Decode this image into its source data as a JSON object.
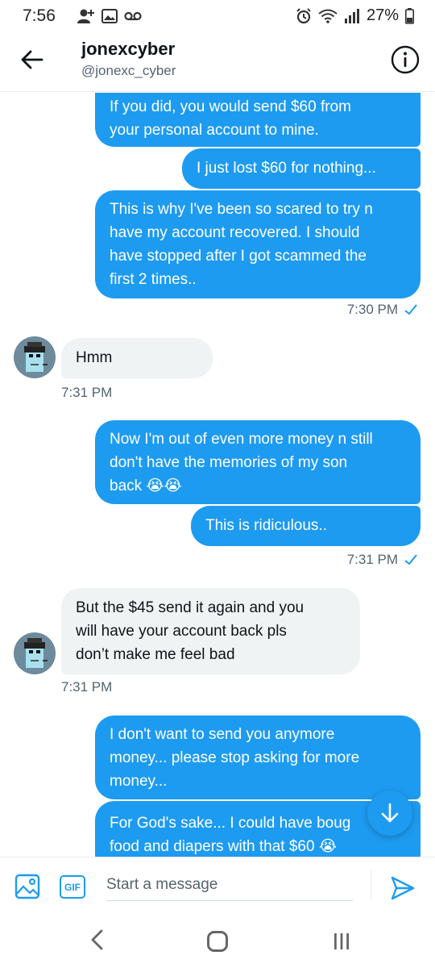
{
  "status_bar": {
    "time": "7:56",
    "battery": "27%",
    "icons": [
      "person-add-icon",
      "image-icon",
      "voicemail-icon",
      "alarm-icon",
      "wifi-icon",
      "signal-icon",
      "battery-icon"
    ]
  },
  "header": {
    "name": "jonexcyber",
    "handle": "@jonexc_cyber",
    "icons": [
      "back-arrow-icon",
      "info-icon"
    ]
  },
  "messages": [
    {
      "dir": "out",
      "text_lines": [
        "If you did, you would send $60 from",
        "your personal account to mine."
      ]
    },
    {
      "dir": "out",
      "text_lines": [
        "I just lost $60 for nothing..."
      ]
    },
    {
      "dir": "out",
      "text_lines": [
        "This is why I've been so scared to try n",
        "have my account recovered. I should",
        "have stopped after I got scammed the",
        "first 2 times.."
      ]
    },
    {
      "dir": "out_ts",
      "timestamp": "7:30 PM"
    },
    {
      "dir": "in",
      "text_lines": [
        "Hmm"
      ]
    },
    {
      "dir": "in_ts",
      "timestamp": "7:31 PM"
    },
    {
      "dir": "out",
      "text_lines": [
        "Now I'm out of even more money n still",
        "don't have the memories of my son",
        "back 😭😭"
      ]
    },
    {
      "dir": "out",
      "text_lines": [
        "This is ridiculous.."
      ]
    },
    {
      "dir": "out_ts",
      "timestamp": "7:31 PM"
    },
    {
      "dir": "in",
      "text_lines": [
        "But the $45 send it again and you",
        "will have your account back pls",
        "don’t make me feel bad"
      ]
    },
    {
      "dir": "in_ts",
      "timestamp": "7:31 PM"
    },
    {
      "dir": "out",
      "text_lines": [
        "I don't want to send you anymore",
        "money... please stop asking for more",
        "money..."
      ]
    },
    {
      "dir": "out",
      "text_lines": [
        "For God's sake... I could have boug",
        "food and diapers with that $60 😭"
      ]
    }
  ],
  "composer": {
    "placeholder": "Start a message",
    "gif_label": "GIF"
  },
  "colors": {
    "accent": "#1d9bf0",
    "incoming_bubble": "#eff3f4",
    "muted_text": "#536471"
  }
}
